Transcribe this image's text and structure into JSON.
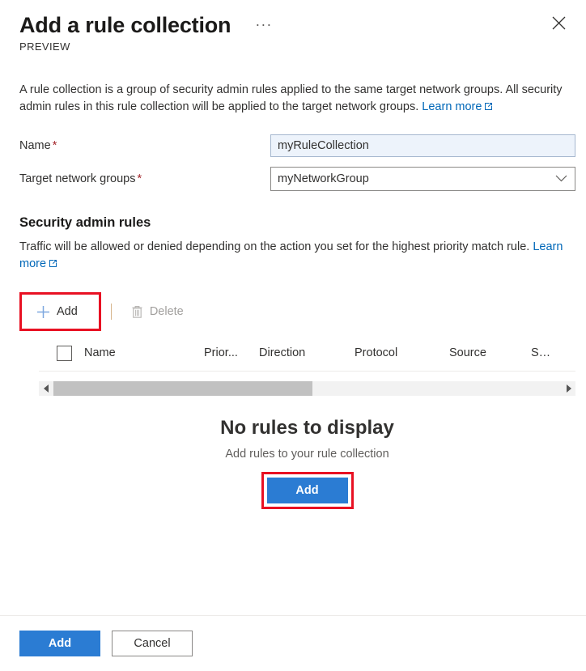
{
  "header": {
    "title": "Add a rule collection",
    "preview_label": "PREVIEW",
    "ellipsis_label": "···",
    "close_label": "Close"
  },
  "intro": {
    "text": "A rule collection is a group of security admin rules applied to the same target network groups. All security admin rules in this rule collection will be applied to the target network groups.",
    "link_label": "Learn more"
  },
  "form": {
    "name": {
      "label": "Name",
      "required_marker": "*",
      "value": "myRuleCollection",
      "placeholder": ""
    },
    "target_network_groups": {
      "label": "Target network groups",
      "required_marker": "*",
      "value": "myNetworkGroup"
    }
  },
  "section": {
    "title": "Security admin rules",
    "description": "Traffic will be allowed or denied depending on the action you set for the highest priority match rule.",
    "link_label": "Learn more"
  },
  "toolbar": {
    "add_label": "Add",
    "delete_label": "Delete"
  },
  "grid": {
    "columns": [
      {
        "label": "Name"
      },
      {
        "label": "Prior..."
      },
      {
        "label": "Direction"
      },
      {
        "label": "Protocol"
      },
      {
        "label": "Source"
      },
      {
        "label": "S…"
      }
    ],
    "rows": [],
    "scrollbar": {
      "left_arrow": "◀",
      "right_arrow": "▶"
    }
  },
  "empty_state": {
    "title": "No rules to display",
    "subtitle": "Add rules to your rule collection",
    "button_label": "Add"
  },
  "footer": {
    "submit_label": "Add",
    "cancel_label": "Cancel"
  },
  "colors": {
    "accent_blue": "#2b7cd3",
    "link_blue": "#0067b8",
    "required_red": "#a4262c",
    "highlight_red": "#e81123",
    "focused_field_bg": "#edf3fb",
    "scrollbar_thumb": "#c1c1c1"
  }
}
